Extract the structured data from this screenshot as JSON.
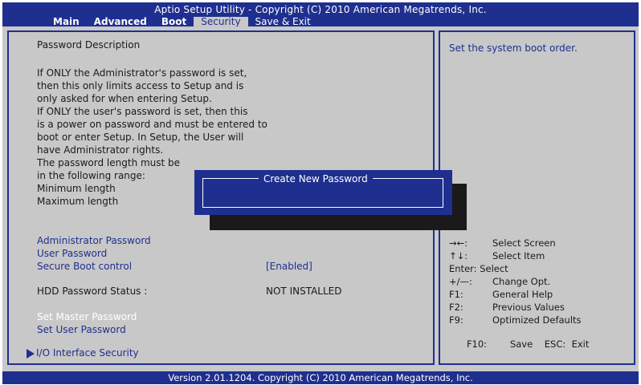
{
  "header": {
    "title": "Aptio Setup Utility - Copyright (C) 2010 American Megatrends, Inc.",
    "menu": [
      {
        "label": "Main"
      },
      {
        "label": "Advanced"
      },
      {
        "label": "Boot"
      },
      {
        "label": "Security"
      },
      {
        "label": "Save & Exit"
      }
    ],
    "active_tab": "Security"
  },
  "description": {
    "heading": "Password Description",
    "lines": [
      "If ONLY the Administrator's password is set,",
      "then this only limits access to Setup and is",
      "only asked for when entering Setup.",
      "If ONLY the user's password is set, then this",
      "is a power on password and must be entered to",
      "boot or enter Setup. In Setup, the User will",
      "have Administrator rights.",
      "The password length must be",
      "in the following range:",
      "Minimum length",
      "Maximum length"
    ]
  },
  "settings": {
    "admin_password": "Administrator Password",
    "user_password": "User Password",
    "secure_boot_label": "Secure Boot control",
    "secure_boot_value": "[Enabled]",
    "hdd_status_label": "HDD Password Status :",
    "hdd_status_value": "NOT INSTALLED",
    "set_master": "Set Master Password",
    "set_user": "Set User Password",
    "io_security": "I/O Interface Security"
  },
  "dialog": {
    "title": "Create New Password"
  },
  "help": {
    "text": "Set the system boot order.",
    "keys": [
      {
        "key": "→←:",
        "action": "Select Screen",
        "icon": "left-right-arrows-icon"
      },
      {
        "key": "↑↓:",
        "action": "Select Item",
        "icon": "up-down-arrows-icon"
      },
      {
        "key": "Enter:",
        "action": "Select"
      },
      {
        "key": "+/—:",
        "action": "Change Opt."
      },
      {
        "key": "F1:",
        "action": "General Help"
      },
      {
        "key": "F2:",
        "action": "Previous Values"
      },
      {
        "key": "F9:",
        "action": "Optimized Defaults"
      },
      {
        "key": "F10:",
        "action": "Save    ESC:  Exit"
      }
    ]
  },
  "footer": {
    "text": "Version 2.01.1204. Copyright (C) 2010 American Megatrends, Inc."
  },
  "colors": {
    "bios_blue": "#1f2f8f",
    "panel_gray": "#c8c8c8",
    "dialog_shadow": "#1a1a1a"
  }
}
